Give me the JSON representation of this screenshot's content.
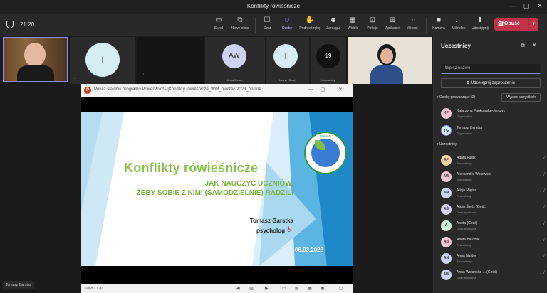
{
  "window": {
    "title": "Konflikty rówieśnicze",
    "minimize": "—",
    "maximize": "▢",
    "close": "✕"
  },
  "toolbar": {
    "timer": "21:20",
    "buttons": [
      {
        "label": "Skroll",
        "icon": "▭"
      },
      {
        "label": "Nowe okno",
        "icon": "⧉"
      },
      {
        "label": "Czat",
        "icon": "☐"
      },
      {
        "label": "Osoby",
        "icon": "☺"
      },
      {
        "label": "Podnieś rękę",
        "icon": "✋"
      },
      {
        "label": "Zareaguj",
        "icon": "☻"
      },
      {
        "label": "Widok",
        "icon": "▦"
      },
      {
        "label": "Pokoje",
        "icon": "⊡"
      },
      {
        "label": "Aplikacje",
        "icon": "⊞"
      },
      {
        "label": "Więcej",
        "icon": "⋯"
      },
      {
        "label": "Kamera",
        "icon": "■"
      },
      {
        "label": "Mikrofon",
        "icon": "♩"
      },
      {
        "label": "Udostępnij",
        "icon": "⬆"
      }
    ],
    "leave_label": "Opuść"
  },
  "gallery": {
    "tiles": [
      {
        "initials": "I",
        "name": ""
      },
      {
        "initials": "AW",
        "name": "Anna Wela..."
      },
      {
        "initials": "I",
        "name": "Iwona (Gość)"
      },
      {
        "initials": "19",
        "name": "Uczestnicy"
      }
    ]
  },
  "presenter_name": "Tomasz Garstka",
  "ppt": {
    "window_title": "Pokaz slajdów programu PowerPoint - [Konflikty rówieśnicze_WiR_marzec 2023_on-line...",
    "slide": {
      "title": "Konflikty rówieśnicze",
      "subtitle_line1": "JAK NAUCZYĆ UCZNIÓW,",
      "subtitle_line2": "ŻEBY SOBIE Z NIMI (SAMODZIELNIE) RADZILI",
      "author": "Tomasz Garstka",
      "role": "psycholog",
      "date": "06.03.2023",
      "logo_text": "FUNDACJA"
    },
    "status": "Slajd 1 z 43"
  },
  "panel": {
    "title": "Uczestnicy",
    "search_placeholder": "Wpisz nazwę",
    "share_invite": "Udostępnij zaproszenie",
    "organizers_label": "Osoby prowadzące (2)",
    "mute_all": "Wycisz wszystkich",
    "attendees_label": "Uczestnicy",
    "organizers": [
      {
        "initials": "KP",
        "name": "Katarzyna Pankowska-Jurczyk",
        "role": "Organizator",
        "color": "#f4c7d6"
      },
      {
        "initials": "TG",
        "name": "Tomasz Garstka",
        "role": "Organizator",
        "color": "#d6eef3"
      }
    ],
    "attendees": [
      {
        "initials": "AF",
        "name": "Agata Fujak",
        "role": "Zewnętrzny",
        "color": "#f6d1a8"
      },
      {
        "initials": "AW",
        "name": "Aleksandra Wołowiec",
        "role": "Zewnętrzny",
        "color": "#f4c7d6"
      },
      {
        "initials": "AM",
        "name": "Alicja Miętus",
        "role": "Zewnętrzny",
        "color": "#cfd3f2"
      },
      {
        "initials": "AŚ",
        "name": "Alicja Śledź (Gość)",
        "role": "Gość spotkania",
        "color": "#d9d4f0"
      },
      {
        "initials": "A",
        "name": "Aneta (Gość)",
        "role": "Gość spotkania",
        "color": "#cfeedd"
      },
      {
        "initials": "AB",
        "name": "Aneta Barczak",
        "role": "Zewnętrzny",
        "color": "#f4c7d6"
      },
      {
        "initials": "AN",
        "name": "Anna Najder",
        "role": "Zewnętrzny",
        "color": "#cfd3f2"
      },
      {
        "initials": "AW",
        "name": "Anna Wełanska-... (Gość)",
        "role": "Gość spotkania",
        "color": "#cfd3f2"
      }
    ]
  }
}
